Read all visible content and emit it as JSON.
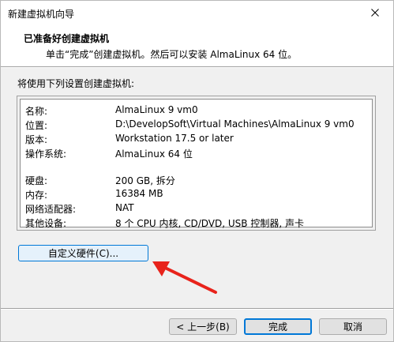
{
  "window": {
    "title": "新建虚拟机向导"
  },
  "header": {
    "title": "已准备好创建虚拟机",
    "subtitle": "单击“完成”创建虚拟机。然后可以安装 AlmaLinux 64 位。"
  },
  "main": {
    "lead": "将使用下列设置创建虚拟机:",
    "settings": [
      {
        "key": "名称:",
        "value": "AlmaLinux 9 vm0"
      },
      {
        "key": "位置:",
        "value": "D:\\DevelopSoft\\Virtual Machines\\AlmaLinux 9 vm0"
      },
      {
        "key": "版本:",
        "value": "Workstation 17.5 or later"
      },
      {
        "key": "操作系统:",
        "value": "AlmaLinux 64 位"
      },
      {
        "key": "硬盘:",
        "value": "200 GB, 拆分"
      },
      {
        "key": "内存:",
        "value": "16384 MB"
      },
      {
        "key": "网络适配器:",
        "value": "NAT"
      },
      {
        "key": "其他设备:",
        "value": "8 个 CPU 内核, CD/DVD, USB 控制器, 声卡"
      }
    ],
    "customize_label": "自定义硬件(C)..."
  },
  "footer": {
    "back_label": "< 上一步(B)",
    "finish_label": "完成",
    "cancel_label": "取消"
  },
  "colors": {
    "accent": "#0078d7",
    "annotation_arrow": "#e8231b"
  },
  "icons": [
    "close-icon",
    "annotation-arrow"
  ]
}
